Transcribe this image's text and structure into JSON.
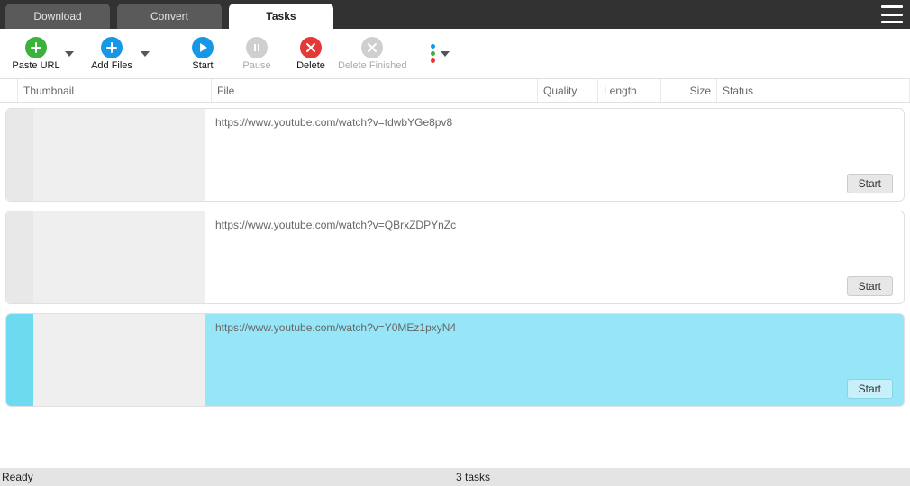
{
  "tabs": [
    {
      "label": "Download",
      "active": false
    },
    {
      "label": "Convert",
      "active": false
    },
    {
      "label": "Tasks",
      "active": true
    }
  ],
  "toolbar": {
    "paste_url": "Paste URL",
    "add_files": "Add Files",
    "start": "Start",
    "pause": "Pause",
    "delete": "Delete",
    "delete_finished": "Delete Finished"
  },
  "columns": {
    "thumbnail": "Thumbnail",
    "file": "File",
    "quality": "Quality",
    "length": "Length",
    "size": "Size",
    "status": "Status"
  },
  "rows": [
    {
      "url": "https://www.youtube.com/watch?v=tdwbYGe8pv8",
      "action": "Start",
      "selected": false
    },
    {
      "url": "https://www.youtube.com/watch?v=QBrxZDPYnZc",
      "action": "Start",
      "selected": false
    },
    {
      "url": "https://www.youtube.com/watch?v=Y0MEz1pxyN4",
      "action": "Start",
      "selected": true
    }
  ],
  "status": {
    "ready": "Ready",
    "tasks": "3 tasks"
  }
}
